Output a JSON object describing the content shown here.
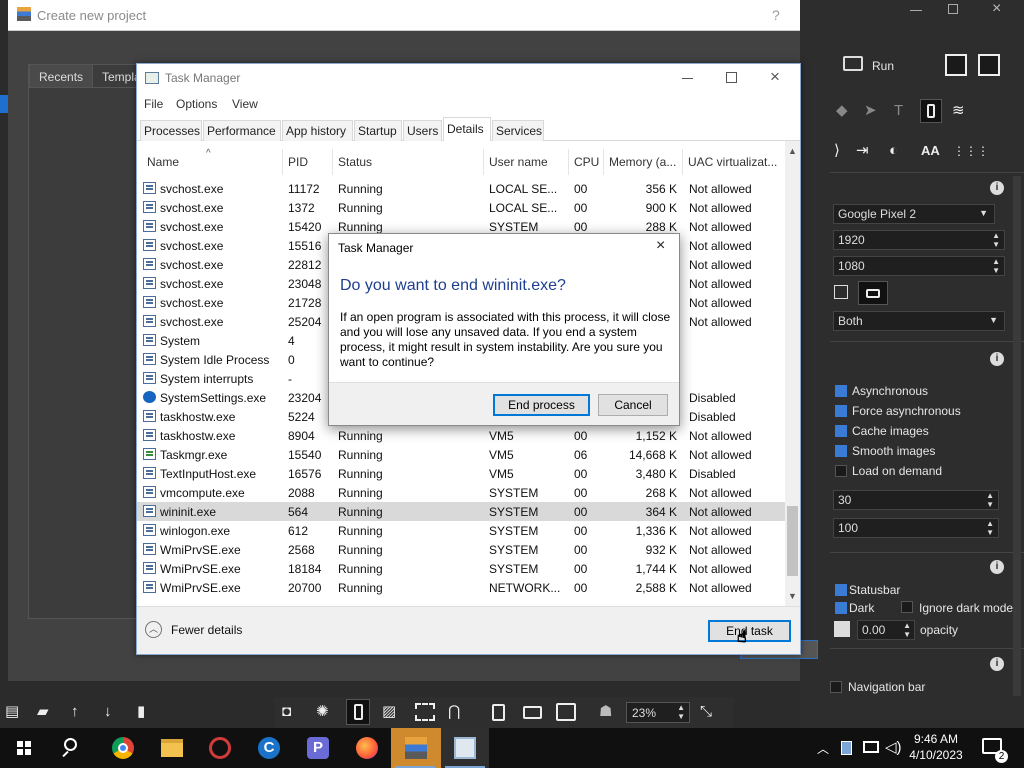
{
  "background_window": {
    "title": "Create new project",
    "help": "?",
    "close": "×",
    "tabs": [
      "Recents",
      "Templa"
    ]
  },
  "right_panel": {
    "run_label": "Run",
    "device": "Google Pixel 2",
    "width": "1920",
    "height": "1080",
    "orientation": "Both",
    "checks": [
      {
        "label": "Asynchronous",
        "on": true
      },
      {
        "label": "Force asynchronous",
        "on": true
      },
      {
        "label": "Cache images",
        "on": true
      },
      {
        "label": "Smooth images",
        "on": true
      },
      {
        "label": "Load on demand",
        "on": false
      }
    ],
    "field_30": "30",
    "field_100": "100",
    "statusbar_label": "Statusbar",
    "dark_label": "Dark",
    "ignore_dark_label": "Ignore dark mode",
    "opacity_value": "0.00",
    "opacity_label": "opacity",
    "navigation_bar_label": "Navigation bar"
  },
  "zoom": {
    "value": "23%"
  },
  "task_manager": {
    "title": "Task Manager",
    "menu": [
      "File",
      "Options",
      "View"
    ],
    "tabs": [
      "Processes",
      "Performance",
      "App history",
      "Startup",
      "Users",
      "Details",
      "Services"
    ],
    "active_tab": "Details",
    "columns": [
      "Name",
      "PID",
      "Status",
      "User name",
      "CPU",
      "Memory (a...",
      "UAC virtualizat..."
    ],
    "rows": [
      {
        "name": "svchost.exe",
        "pid": "11172",
        "status": "Running",
        "user": "LOCAL SE...",
        "cpu": "00",
        "mem": "356 K",
        "uac": "Not allowed",
        "icon": "app"
      },
      {
        "name": "svchost.exe",
        "pid": "1372",
        "status": "Running",
        "user": "LOCAL SE...",
        "cpu": "00",
        "mem": "900 K",
        "uac": "Not allowed",
        "icon": "app"
      },
      {
        "name": "svchost.exe",
        "pid": "15420",
        "status": "Running",
        "user": "SYSTEM",
        "cpu": "00",
        "mem": "288 K",
        "uac": "Not allowed",
        "icon": "app"
      },
      {
        "name": "svchost.exe",
        "pid": "15516",
        "status": "",
        "user": "",
        "cpu": "",
        "mem": "",
        "uac": "Not allowed",
        "icon": "app"
      },
      {
        "name": "svchost.exe",
        "pid": "22812",
        "status": "",
        "user": "",
        "cpu": "",
        "mem": "",
        "uac": "Not allowed",
        "icon": "app"
      },
      {
        "name": "svchost.exe",
        "pid": "23048",
        "status": "",
        "user": "",
        "cpu": "",
        "mem": "",
        "uac": "Not allowed",
        "icon": "app"
      },
      {
        "name": "svchost.exe",
        "pid": "21728",
        "status": "",
        "user": "",
        "cpu": "",
        "mem": "",
        "uac": "Not allowed",
        "icon": "app"
      },
      {
        "name": "svchost.exe",
        "pid": "25204",
        "status": "",
        "user": "",
        "cpu": "",
        "mem": "",
        "uac": "Not allowed",
        "icon": "app"
      },
      {
        "name": "System",
        "pid": "4",
        "status": "",
        "user": "",
        "cpu": "",
        "mem": "",
        "uac": "",
        "icon": "app"
      },
      {
        "name": "System Idle Process",
        "pid": "0",
        "status": "",
        "user": "",
        "cpu": "",
        "mem": "",
        "uac": "",
        "icon": "app"
      },
      {
        "name": "System interrupts",
        "pid": "-",
        "status": "",
        "user": "",
        "cpu": "",
        "mem": "",
        "uac": "",
        "icon": "app"
      },
      {
        "name": "SystemSettings.exe",
        "pid": "23204",
        "status": "",
        "user": "",
        "cpu": "",
        "mem": "",
        "uac": "Disabled",
        "icon": "gear"
      },
      {
        "name": "taskhostw.exe",
        "pid": "5224",
        "status": "",
        "user": "",
        "cpu": "",
        "mem": "",
        "uac": "Disabled",
        "icon": "app"
      },
      {
        "name": "taskhostw.exe",
        "pid": "8904",
        "status": "Running",
        "user": "VM5",
        "cpu": "00",
        "mem": "1,152 K",
        "uac": "Not allowed",
        "icon": "app"
      },
      {
        "name": "Taskmgr.exe",
        "pid": "15540",
        "status": "Running",
        "user": "VM5",
        "cpu": "06",
        "mem": "14,668 K",
        "uac": "Not allowed",
        "icon": "tm"
      },
      {
        "name": "TextInputHost.exe",
        "pid": "16576",
        "status": "Running",
        "user": "VM5",
        "cpu": "00",
        "mem": "3,480 K",
        "uac": "Disabled",
        "icon": "app"
      },
      {
        "name": "vmcompute.exe",
        "pid": "2088",
        "status": "Running",
        "user": "SYSTEM",
        "cpu": "00",
        "mem": "268 K",
        "uac": "Not allowed",
        "icon": "app"
      },
      {
        "name": "wininit.exe",
        "pid": "564",
        "status": "Running",
        "user": "SYSTEM",
        "cpu": "00",
        "mem": "364 K",
        "uac": "Not allowed",
        "icon": "app",
        "selected": true
      },
      {
        "name": "winlogon.exe",
        "pid": "612",
        "status": "Running",
        "user": "SYSTEM",
        "cpu": "00",
        "mem": "1,336 K",
        "uac": "Not allowed",
        "icon": "app"
      },
      {
        "name": "WmiPrvSE.exe",
        "pid": "2568",
        "status": "Running",
        "user": "SYSTEM",
        "cpu": "00",
        "mem": "932 K",
        "uac": "Not allowed",
        "icon": "app"
      },
      {
        "name": "WmiPrvSE.exe",
        "pid": "18184",
        "status": "Running",
        "user": "SYSTEM",
        "cpu": "00",
        "mem": "1,744 K",
        "uac": "Not allowed",
        "icon": "app"
      },
      {
        "name": "WmiPrvSE.exe",
        "pid": "20700",
        "status": "Running",
        "user": "NETWORK...",
        "cpu": "00",
        "mem": "2,588 K",
        "uac": "Not allowed",
        "icon": "app"
      }
    ],
    "fewer_details": "Fewer details",
    "end_task": "End task"
  },
  "dialog": {
    "title": "Task Manager",
    "question": "Do you want to end wininit.exe?",
    "message": "If an open program is associated with this process, it will close and you will lose any unsaved data. If you end a system process, it might result in system instability. Are you sure you want to continue?",
    "end_process": "End process",
    "cancel": "Cancel"
  },
  "taskbar": {
    "time": "9:46 AM",
    "date": "4/10/2023",
    "notifications": "2"
  }
}
